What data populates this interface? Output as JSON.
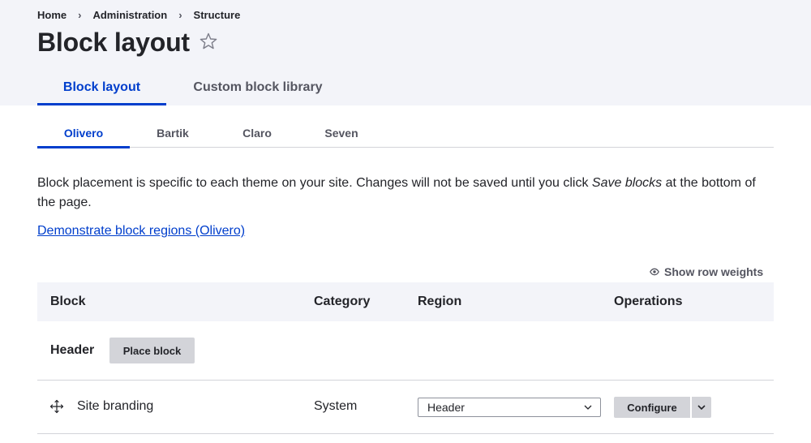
{
  "breadcrumb": {
    "items": [
      "Home",
      "Administration",
      "Structure"
    ],
    "separator": "›"
  },
  "page": {
    "title": "Block layout",
    "favorite_icon": "star-outline-icon"
  },
  "primary_tabs": [
    {
      "label": "Block layout",
      "active": true
    },
    {
      "label": "Custom block library",
      "active": false
    }
  ],
  "theme_tabs": [
    {
      "label": "Olivero",
      "active": true
    },
    {
      "label": "Bartik",
      "active": false
    },
    {
      "label": "Claro",
      "active": false
    },
    {
      "label": "Seven",
      "active": false
    }
  ],
  "intro": {
    "text_before": "Block placement is specific to each theme on your site. Changes will not be saved until you click ",
    "emphasis": "Save blocks",
    "text_after": " at the bottom of the page."
  },
  "demo_link": "Demonstrate block regions (Olivero)",
  "row_weights_toggle": {
    "label": "Show row weights",
    "icon": "eye-icon"
  },
  "table": {
    "columns": [
      "Block",
      "Category",
      "Region",
      "Operations"
    ],
    "regions": [
      {
        "title": "Header",
        "place_block_label": "Place block",
        "blocks": [
          {
            "name": "Site branding",
            "category": "System",
            "region": "Header",
            "configure_label": "Configure"
          }
        ]
      }
    ]
  },
  "colors": {
    "accent": "#003ecc",
    "header_background": "#f3f4f9",
    "button_gray": "#d3d4d9",
    "text": "#232429"
  }
}
